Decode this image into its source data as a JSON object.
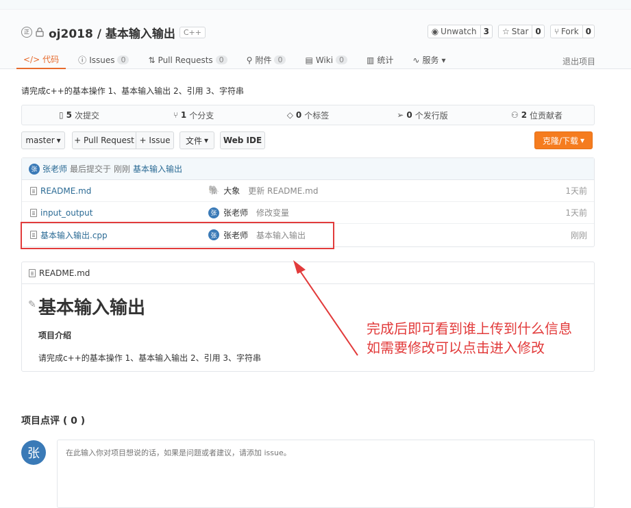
{
  "repo": {
    "name": "oj2018 / 基本输入输出",
    "lang": "C++",
    "description": "请完成c++的基本操作 1、基本输入输出 2、引用 3、字符串"
  },
  "actions": {
    "watch": {
      "label": "Unwatch",
      "count": "3"
    },
    "star": {
      "label": "Star",
      "count": "0"
    },
    "fork": {
      "label": "Fork",
      "count": "0"
    }
  },
  "tabs": [
    {
      "label": "代码",
      "badge": ""
    },
    {
      "label": "Issues",
      "badge": "0"
    },
    {
      "label": "Pull Requests",
      "badge": "0"
    },
    {
      "label": "附件",
      "badge": "0"
    },
    {
      "label": "Wiki",
      "badge": "0"
    },
    {
      "label": "统计",
      "badge": ""
    },
    {
      "label": "服务",
      "badge": ""
    }
  ],
  "exit_label": "退出项目",
  "stats": [
    {
      "num": "5",
      "label": "次提交"
    },
    {
      "num": "1",
      "label": "个分支"
    },
    {
      "num": "0",
      "label": "个标签"
    },
    {
      "num": "0",
      "label": "个发行版"
    },
    {
      "num": "2",
      "label": "位贡献者"
    }
  ],
  "toolbar": {
    "branch": "master",
    "pull_request": "+ Pull Request",
    "issue": "+ Issue",
    "file": "文件",
    "webide": "Web IDE",
    "clone": "克隆/下载"
  },
  "last_commit": {
    "avatar": "张",
    "author": "张老师",
    "text": "最后提交于",
    "time": "刚刚",
    "message": "基本输入输出"
  },
  "files": [
    {
      "name": "README.md",
      "avatar": "🐘",
      "author": "大象",
      "message": "更新 README.md",
      "time": "1天前"
    },
    {
      "name": "input_output",
      "avatar": "张",
      "author": "张老师",
      "message": "修改变量",
      "time": "1天前"
    },
    {
      "name": "基本输入输出.cpp",
      "avatar": "张",
      "author": "张老师",
      "message": "基本输入输出",
      "time": "刚刚"
    }
  ],
  "readme": {
    "filename": "README.md",
    "title": "基本输入输出",
    "section": "项目介绍",
    "body": "请完成c++的基本操作 1、基本输入输出 2、引用 3、字符串"
  },
  "annotation": {
    "line1": "完成后即可看到谁上传到什么信息",
    "line2": "如需要修改可以点击进入修改",
    "color": "#e23b3b"
  },
  "review": {
    "title": "项目点评 ( 0 )",
    "avatar": "张",
    "placeholder": "在此输入你对项目想说的话，如果是问题或者建议，请添加 issue。"
  },
  "colors": {
    "accent": "#e66a2c",
    "clone_button": "#f57c1f",
    "link": "#2a6a94",
    "avatar": "#3a7ab7"
  }
}
